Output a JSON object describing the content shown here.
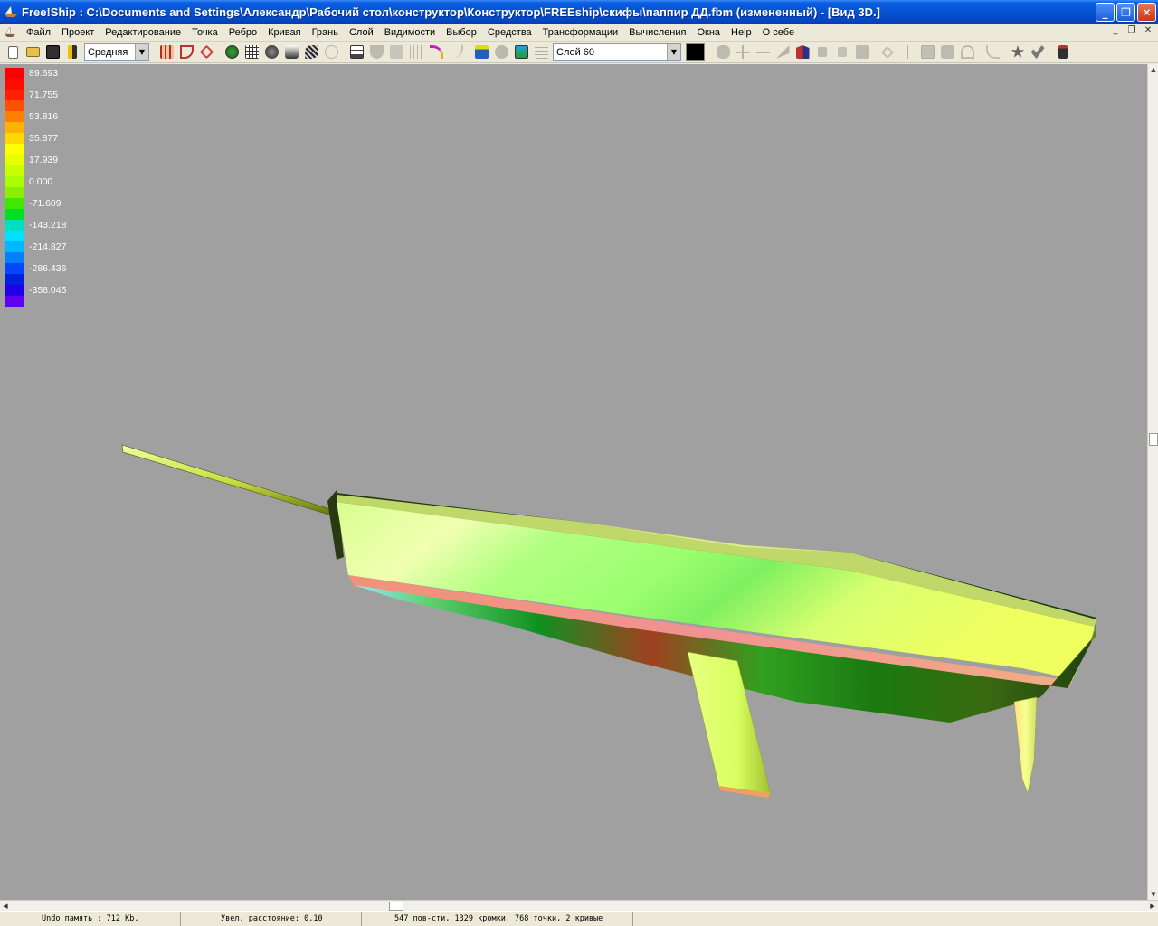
{
  "window": {
    "title": "Free!Ship  : C:\\Documents and Settings\\Александр\\Рабочий стол\\конструктор\\Конструктор\\FREEship\\скифы\\паппир ДД.fbm (измененный) - [Вид 3D.]",
    "minimize_glyph": "_",
    "restore_glyph": "❐",
    "close_glyph": "✕"
  },
  "menu": {
    "items": [
      "Файл",
      "Проект",
      "Редактирование",
      "Точка",
      "Ребро",
      "Кривая",
      "Грань",
      "Слой",
      "Видимости",
      "Выбор",
      "Средства",
      "Трансформации",
      "Вычисления",
      "Окна",
      "Help",
      "О себе"
    ],
    "mdi_minimize": "_",
    "mdi_restore": "❐",
    "mdi_close": "✕"
  },
  "toolbar": {
    "precision_value": "Средняя",
    "layer_value": "Слой 60",
    "layer_color": "#000000"
  },
  "legend": {
    "labels": [
      "89.693",
      "71.755",
      "53.816",
      "35.877",
      "17.939",
      "0.000",
      "-71.609",
      "-143.218",
      "-214.827",
      "-286.436",
      "-358.045"
    ],
    "colors": [
      "#ff0000",
      "#ff0a00",
      "#ff2000",
      "#ff5000",
      "#ff8000",
      "#ffb000",
      "#ffd800",
      "#ffff00",
      "#e8ff00",
      "#c8ff00",
      "#a8ff00",
      "#88f000",
      "#40e800",
      "#00e020",
      "#00e0c0",
      "#00e0ff",
      "#00b8ff",
      "#0080ff",
      "#0048ff",
      "#0020e0",
      "#2000e8",
      "#6000f0"
    ]
  },
  "statusbar": {
    "undo": "Undo память : 712 Kb.",
    "distance": "Увел. расстояние: 0.10",
    "counts": "547 пов-сти, 1329 кромки, 768 точки, 2 кривые"
  }
}
